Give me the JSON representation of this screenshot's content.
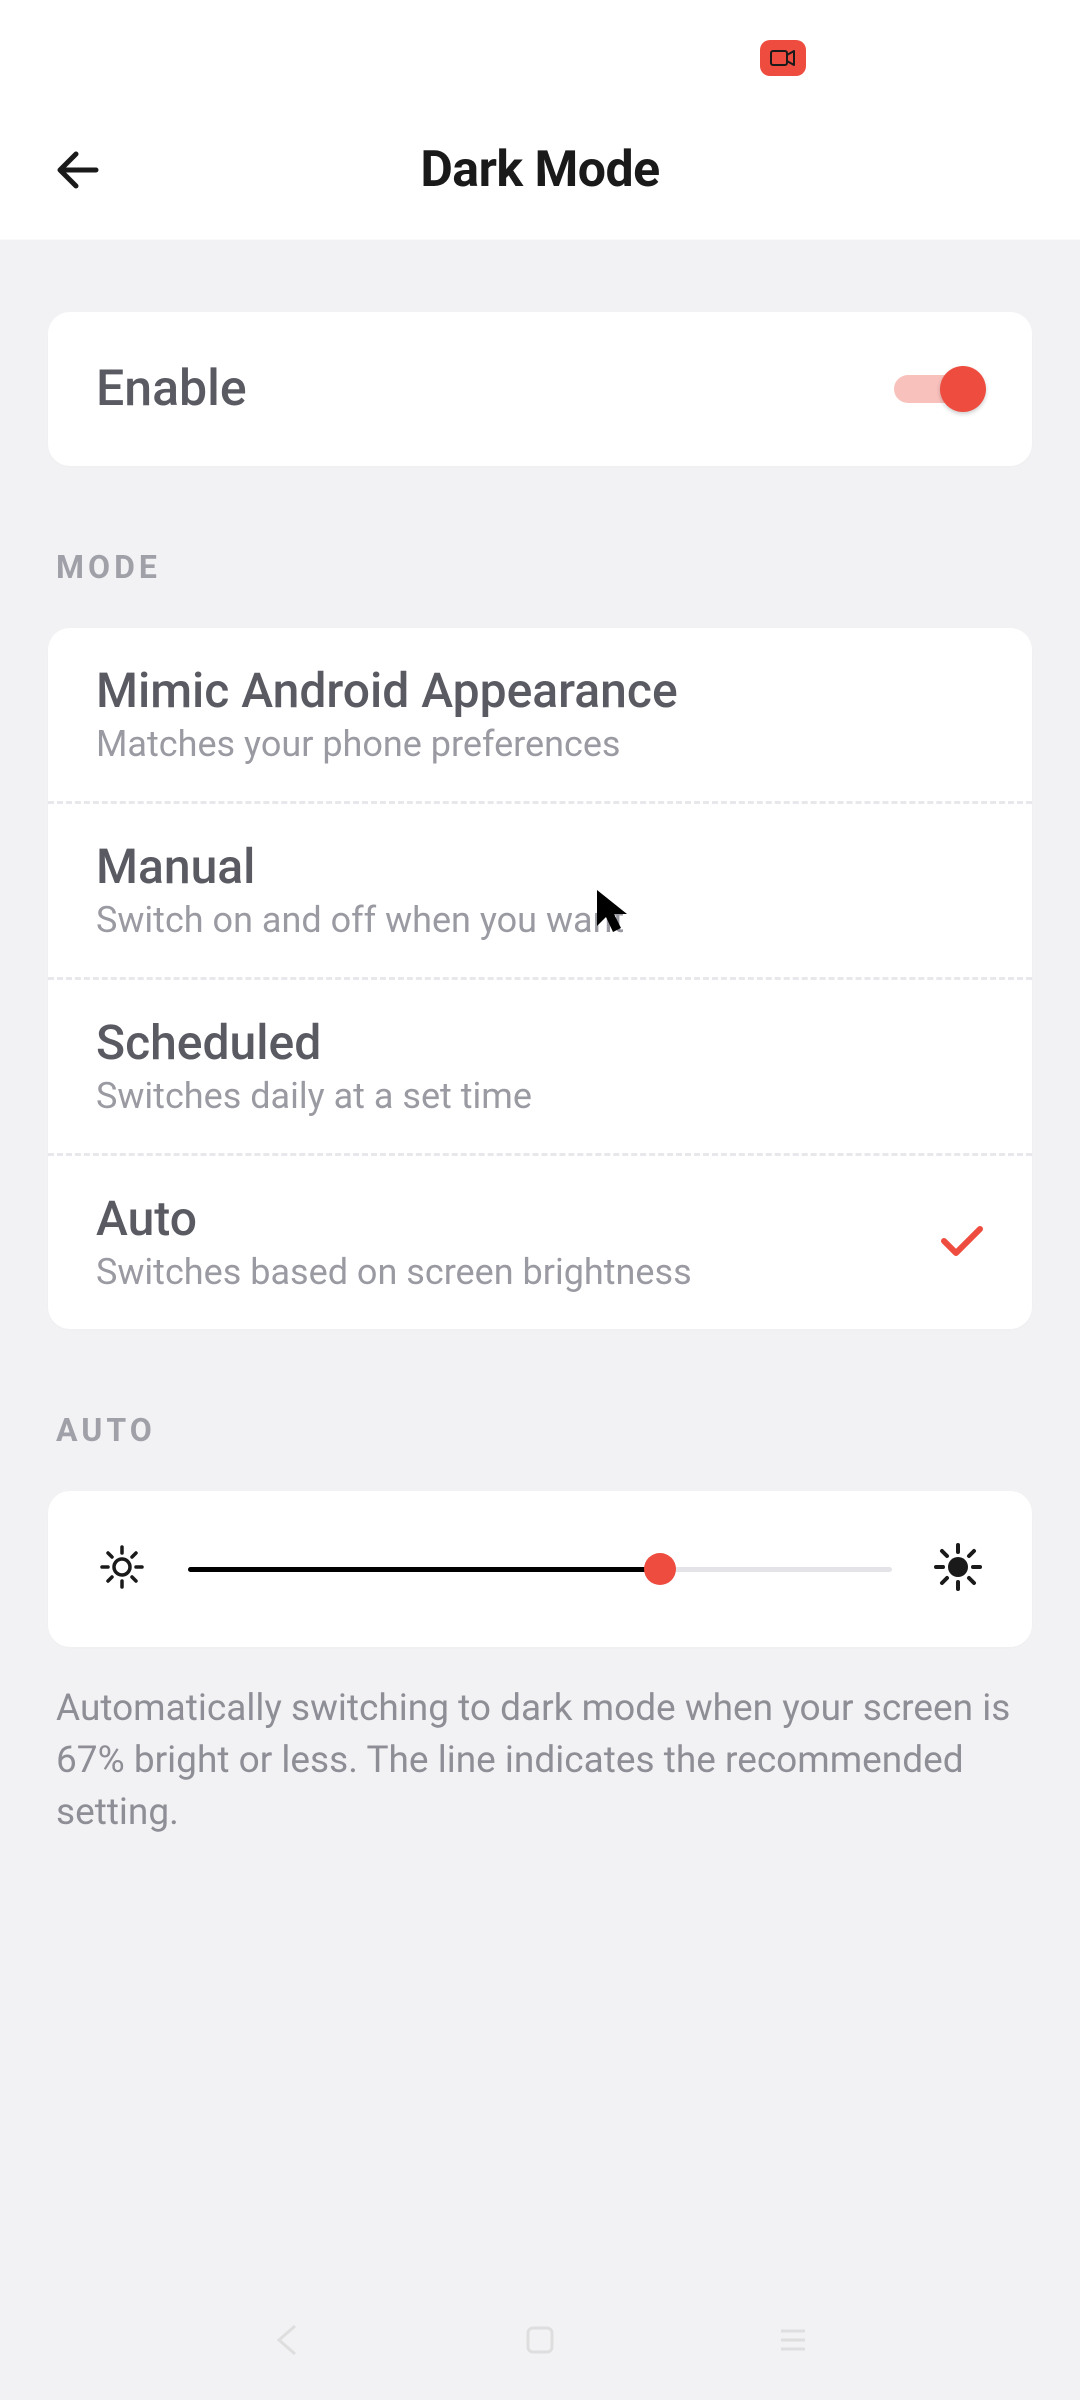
{
  "header": {
    "title": "Dark Mode"
  },
  "enable": {
    "label": "Enable",
    "value": true
  },
  "mode_section": {
    "header": "MODE"
  },
  "modes": [
    {
      "title": "Mimic Android Appearance",
      "sub": "Matches your phone preferences",
      "selected": false
    },
    {
      "title": "Manual",
      "sub": "Switch on and off when you want",
      "selected": false
    },
    {
      "title": "Scheduled",
      "sub": "Switches daily at a set time",
      "selected": false
    },
    {
      "title": "Auto",
      "sub": "Switches based on screen brightness",
      "selected": true
    }
  ],
  "auto_section": {
    "header": "AUTO"
  },
  "slider": {
    "value_pct": 67
  },
  "helper": "Automatically switching to dark mode when your screen is 67% bright or less. The line indicates the recommended setting.",
  "colors": {
    "accent": "#ed4c3f"
  }
}
